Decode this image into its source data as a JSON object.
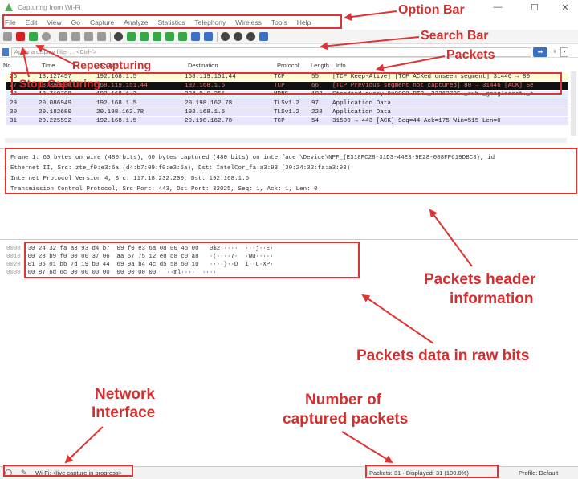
{
  "window": {
    "title": "Capturing from Wi-Fi",
    "minimize": "—",
    "maximize": "☐",
    "close": "✕"
  },
  "menu": [
    "File",
    "Edit",
    "View",
    "Go",
    "Capture",
    "Analyze",
    "Statistics",
    "Telephony",
    "Wireless",
    "Tools",
    "Help"
  ],
  "toolbar_icons": [
    "shark-fin-icon",
    "stop-icon",
    "restart-icon",
    "options-icon",
    "open-icon",
    "save-icon",
    "close-file-icon",
    "reload-icon",
    "find-icon",
    "back-icon",
    "forward-icon",
    "goto-icon",
    "first-icon",
    "last-icon",
    "autoscroll-icon",
    "colorize-icon",
    "zoom-in-icon",
    "zoom-out-icon",
    "zoom-reset-icon",
    "resize-columns-icon"
  ],
  "filter": {
    "placeholder": "Apply a display filter ... <Ctrl-/>",
    "apply": "➡",
    "plus": "+",
    "dropdown": "▾"
  },
  "columns": {
    "no": "No.",
    "time": "Time",
    "source": "Source",
    "destination": "Destination",
    "protocol": "Protocol",
    "length": "Length",
    "info": "Info"
  },
  "packets": [
    {
      "no": "26",
      "time": "18.127457",
      "source": "192.168.1.5",
      "destination": "168.119.151.44",
      "protocol": "TCP",
      "length": "55",
      "info": "[TCP Keep-Alive] [TCP ACKed unseen segment] 31446 → 80",
      "bg": "#fffbd4",
      "fg": "#222222"
    },
    {
      "no": "27",
      "time": "18.393000",
      "source": "168.119.151.44",
      "destination": "192.168.1.5",
      "protocol": "TCP",
      "length": "66",
      "info": "[TCP Previous segment not captured] 80 → 31446 [ACK] Se",
      "bg": "#111111",
      "fg": "#ff6b6b"
    },
    {
      "no": "28",
      "time": "18.719708",
      "source": "192.168.1.3",
      "destination": "224.0.0.251",
      "protocol": "MDNS",
      "length": "103",
      "info": "Standard query 0x0000 PTR _233637DE._sub._googlecast._t",
      "bg": "#e4f0ff",
      "fg": "#222222"
    },
    {
      "no": "29",
      "time": "20.086949",
      "source": "192.168.1.5",
      "destination": "20.198.162.78",
      "protocol": "TLSv1.2",
      "length": "97",
      "info": "Application Data",
      "bg": "#e8e4fb",
      "fg": "#222222"
    },
    {
      "no": "30",
      "time": "20.182680",
      "source": "20.198.162.78",
      "destination": "192.168.1.5",
      "protocol": "TLSv1.2",
      "length": "228",
      "info": "Application Data",
      "bg": "#e8e4fb",
      "fg": "#222222"
    },
    {
      "no": "31",
      "time": "20.225592",
      "source": "192.168.1.5",
      "destination": "20.198.162.78",
      "protocol": "TCP",
      "length": "54",
      "info": "31500 → 443 [ACK] Seq=44 Ack=175 Win=515 Len=0",
      "bg": "#e8e4fb",
      "fg": "#222222"
    }
  ],
  "details": [
    "Frame 1: 60 bytes on wire (480 bits), 60 bytes captured (480 bits) on interface \\Device\\NPF_{E318FC28-31D3-44E3-9E28-088FF619DBC3}, id",
    "Ethernet II, Src: zte_f0:e3:6a (d4:b7:09:f0:e3:6a), Dst: IntelCor_fa:a3:93 (30:24:32:fa:a3:93)",
    "Internet Protocol Version 4, Src: 117.18.232.200, Dst: 192.168.1.5",
    "Transmission Control Protocol, Src Port: 443, Dst Port: 32025, Seq: 1, Ack: 1, Len: 0"
  ],
  "hex": [
    {
      "offset": "0000",
      "bytes": "30 24 32 fa a3 93 d4 b7  09 f0 e3 6a 08 00 45 00",
      "ascii": "0$2·····  ···j··E·"
    },
    {
      "offset": "0010",
      "bytes": "00 28 b9 f0 00 00 37 06  aa 57 75 12 e8 c8 c0 a8",
      "ascii": "·(····7·  ·Wu·····"
    },
    {
      "offset": "0020",
      "bytes": "01 05 01 bb 7d 19 b0 44  69 9a b4 4c d5 58 50 10",
      "ascii": "····}··D  i··L·XP·"
    },
    {
      "offset": "0030",
      "bytes": "00 87 6d 6c 00 00 00 00  00 00 00 00",
      "ascii": "··ml····  ····"
    }
  ],
  "status": {
    "interface": "Wi-Fi: <live capture in progress>",
    "counts": "Packets: 31 · Displayed: 31 (100.0%)",
    "profile": "Profile: Default"
  },
  "annotations": {
    "option_bar": "Option Bar",
    "search_bar": "Search Bar",
    "packets": "Packets",
    "repecapturing": "Repecapturing",
    "stop_capturing": "Stop Capturing",
    "header_info_1": "Packets header",
    "header_info_2": "information",
    "raw_bits": "Packets data in raw bits",
    "network_1": "Network",
    "network_2": "Interface",
    "captured_1": "Number of",
    "captured_2": "captured packets"
  },
  "colors": {
    "annotation": "#e03333",
    "selected_row": "#111111",
    "keepalive_row": "#fffbd4",
    "mdns_row": "#e4f0ff",
    "tls_row": "#e8e4fb"
  }
}
